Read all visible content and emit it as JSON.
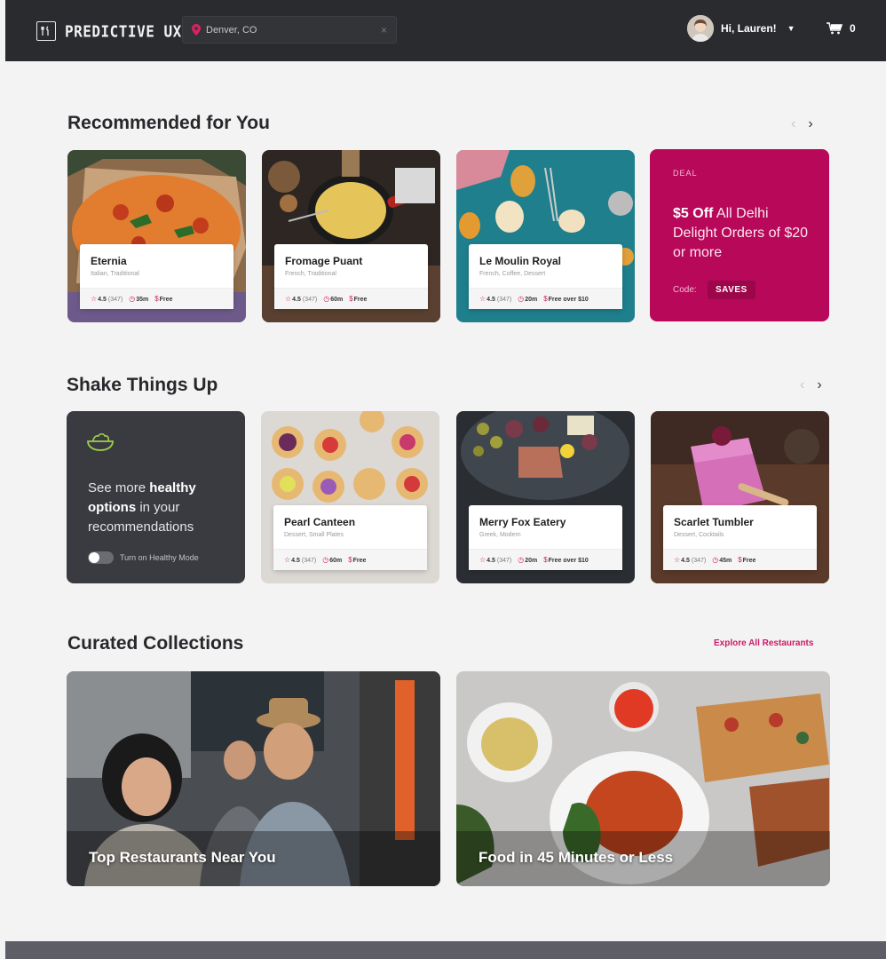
{
  "header": {
    "logo_text": "PREDICTIVE UX",
    "search_value": "Denver, CO",
    "clear_icon": "×",
    "greeting": "Hi, Lauren!",
    "cart_count": "0"
  },
  "recommended": {
    "title": "Recommended for You",
    "cards": [
      {
        "name": "Eternia",
        "cuisine": "Italian, Traditional",
        "rating": "4.5",
        "reviews": "(347)",
        "time": "35m",
        "delivery": "Free"
      },
      {
        "name": "Fromage Puant",
        "cuisine": "French, Traditional",
        "rating": "4.5",
        "reviews": "(347)",
        "time": "60m",
        "delivery": "Free"
      },
      {
        "name": "Le Moulin Royal",
        "cuisine": "French, Coffee, Dessert",
        "rating": "4.5",
        "reviews": "(347)",
        "time": "20m",
        "delivery": "Free over $10"
      }
    ],
    "deal": {
      "label": "DEAL",
      "highlight": "$5 Off",
      "text": " All Delhi Delight Orders of $20 or more",
      "code_label": "Code:",
      "code": "SAVES"
    }
  },
  "shake": {
    "title": "Shake Things Up",
    "healthy": {
      "pre": "See more ",
      "bold1": "healthy",
      "bold2": "options",
      "post": " in your recommendations",
      "toggle_label": "Turn on Healthy Mode"
    },
    "cards": [
      {
        "name": "Pearl Canteen",
        "cuisine": "Dessert, Small Plates",
        "rating": "4.5",
        "reviews": "(347)",
        "time": "60m",
        "delivery": "Free"
      },
      {
        "name": "Merry Fox Eatery",
        "cuisine": "Greek, Modern",
        "rating": "4.5",
        "reviews": "(347)",
        "time": "20m",
        "delivery": "Free over $10"
      },
      {
        "name": "Scarlet Tumbler",
        "cuisine": "Dessert, Cocktails",
        "rating": "4.5",
        "reviews": "(347)",
        "time": "45m",
        "delivery": "Free"
      }
    ]
  },
  "curated": {
    "title": "Curated Collections",
    "explore": "Explore All Restaurants",
    "items": [
      {
        "title": "Top Restaurants Near You"
      },
      {
        "title": "Food in 45 Minutes or Less"
      }
    ]
  },
  "colors": {
    "accent": "#cc1a66",
    "deal_bg": "#b8085a",
    "header_bg": "#2a2b2f"
  }
}
